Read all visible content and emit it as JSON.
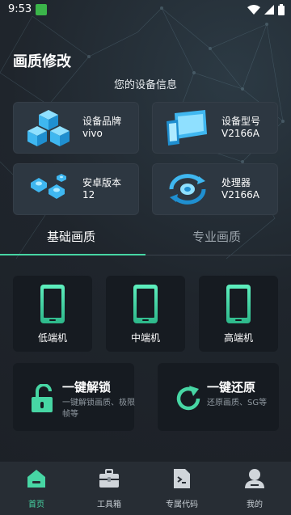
{
  "status_bar": {
    "time": "9:53"
  },
  "page": {
    "title": "画质修改"
  },
  "device_info": {
    "section_title": "您的设备信息",
    "cards": [
      {
        "label": "设备品牌",
        "value": "vivo",
        "icon": "cubes-icon"
      },
      {
        "label": "设备型号",
        "value": "V2166A",
        "icon": "devices-icon"
      },
      {
        "label": "安卓版本",
        "value": "12",
        "icon": "nuts-icon"
      },
      {
        "label": "处理器",
        "value": "V2166A",
        "icon": "cpu-sync-icon"
      }
    ]
  },
  "tabs": [
    {
      "label": "基础画质",
      "active": true
    },
    {
      "label": "专业画质",
      "active": false
    }
  ],
  "presets": [
    {
      "label": "低端机"
    },
    {
      "label": "中端机"
    },
    {
      "label": "高端机"
    }
  ],
  "actions": [
    {
      "title": "一键解锁",
      "desc": "一键解锁画质、极限帧等",
      "icon": "unlock-icon"
    },
    {
      "title": "一键还原",
      "desc": "还原画质、SG等",
      "icon": "restore-icon"
    }
  ],
  "bottom_nav": [
    {
      "label": "首页",
      "icon": "home-icon",
      "active": true
    },
    {
      "label": "工具箱",
      "icon": "toolbox-icon",
      "active": false
    },
    {
      "label": "专属代码",
      "icon": "code-file-icon",
      "active": false
    },
    {
      "label": "我的",
      "icon": "profile-icon",
      "active": false
    }
  ],
  "colors": {
    "accent": "#47d6a4",
    "card_bg": "#2d3741",
    "dark_card_bg": "#161b21",
    "nav_bg": "#272d34",
    "icon_blue": "#3fb7f0"
  }
}
